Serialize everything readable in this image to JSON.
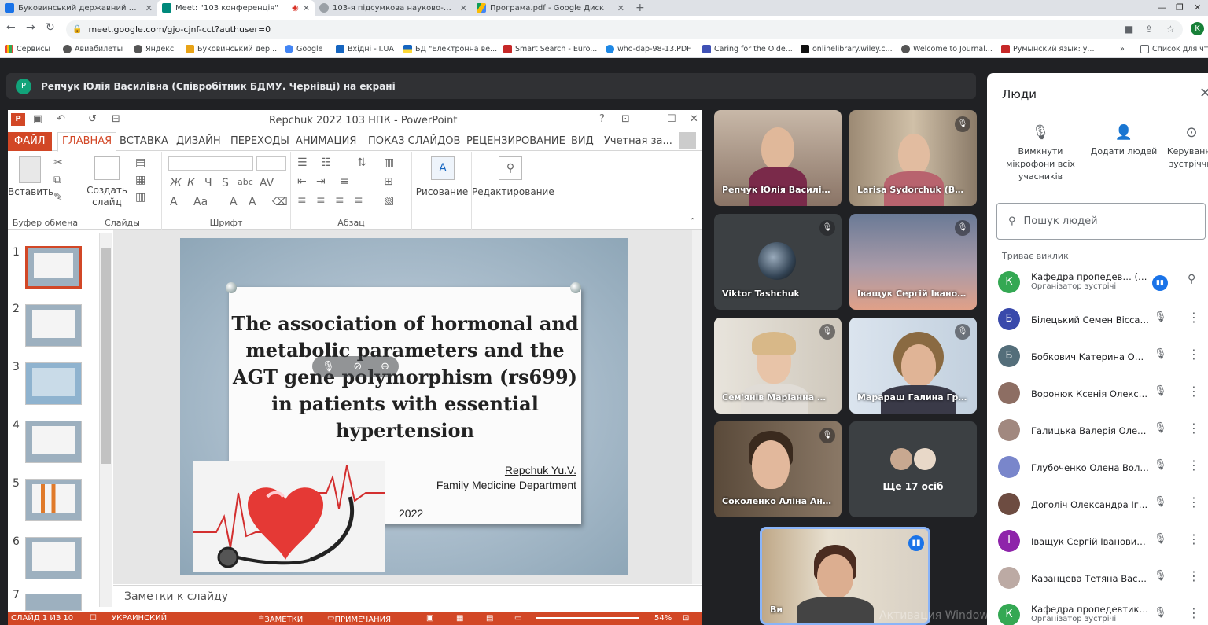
{
  "browser": {
    "tabs": [
      {
        "title": "Буковинський державний медичн…",
        "color": "#1a73e8"
      },
      {
        "title": "Meet: \"103 конференція\"",
        "color": "#00897b",
        "recording": true
      },
      {
        "title": "103-я підсумкова науково-прак…",
        "color": "#5f6368"
      },
      {
        "title": "Програма.pdf - Google Диск",
        "color": "#fbbc04"
      }
    ],
    "url": "meet.google.com/gjo-cjnf-cct?authuser=0",
    "profile_letter": "K",
    "bookmarks": [
      "Сервисы",
      "Авиабилеты",
      "Яндекс",
      "Буковинський дер...",
      "Google",
      "Вхідні - I.UA",
      "БД \"Електронна ве...",
      "Smart Search - Euro...",
      "who-dap-98-13.PDF",
      "Caring for the Olde...",
      "onlinelibrary.wiley.c...",
      "Welcome to Journal...",
      "Румынский язык: у...",
      "»",
      "Список для чт"
    ]
  },
  "meet": {
    "presenter_banner": "Репчук Юлія Василівна (Співробітник БДМУ. Чернівці) на екрані",
    "presenter_avatar": "Р",
    "tiles": [
      {
        "name": "Репчук Юлія Василівн…",
        "muted": false
      },
      {
        "name": "Larisa Sydorchuk (BS…",
        "muted": true
      },
      {
        "name": "Viktor Tashchuk",
        "muted": true
      },
      {
        "name": "Іващук Сергій Іванов…",
        "muted": true
      },
      {
        "name": "Сем'янів Маріанна М…",
        "muted": true
      },
      {
        "name": "Марараш Галина Григ…",
        "muted": true
      },
      {
        "name": "Соколенко Аліна Анд…",
        "muted": true
      },
      {
        "name": "Ще 17 осіб",
        "muted": false
      },
      {
        "name": "Ви",
        "muted": false
      }
    ],
    "watermark": "Активация Windows"
  },
  "powerpoint": {
    "window_title": "Repchuk 2022 103 НПК - PowerPoint",
    "menu": [
      "ФАЙЛ",
      "ГЛАВНАЯ",
      "ВСТАВКА",
      "ДИЗАЙН",
      "ПЕРЕХОДЫ",
      "АНИМАЦИЯ",
      "ПОКАЗ СЛАЙДОВ",
      "РЕЦЕНЗИРОВАНИЕ",
      "ВИД",
      "Учетная за..."
    ],
    "ribbon": {
      "paste": "Вставить",
      "new_slide": "Создать слайд",
      "draw": "Рисование",
      "edit": "Редактирование",
      "groups": [
        "Буфер обмена",
        "Слайды",
        "Шрифт",
        "Абзац"
      ]
    },
    "slide_numbers": [
      "1",
      "2",
      "3",
      "4",
      "5",
      "6",
      "7"
    ],
    "slide": {
      "title": "The association of hormonal and metabolic parameters and the AGT gene polymorphism (rs699) in patients with essential hypertension",
      "author": "Repchuk Yu.V.",
      "department": "Family Medicine Department",
      "year": "2022"
    },
    "notes_placeholder": "Заметки к слайду",
    "status": {
      "slide_of": "СЛАЙД 1 ИЗ 10",
      "language": "УКРАИНСКИЙ",
      "notes": "ЗАМЕТКИ",
      "comments": "ПРИМЕЧАНИЯ",
      "zoom": "54%"
    }
  },
  "people_panel": {
    "title": "Люди",
    "actions": [
      "Вимкнути мікрофони всіх учасників",
      "Додати людей",
      "Керування зустріччю"
    ],
    "search_placeholder": "Пошук людей",
    "section": "Триває виклик",
    "people": [
      {
        "name": "Кафедра пропедев… (Ви)",
        "sub": "Організатор зустрічі",
        "letter": "К",
        "color": "#34a853",
        "speaking": true
      },
      {
        "name": "Білецький Семен Віссарі…",
        "sub": "",
        "letter": "Б",
        "color": "#3949ab"
      },
      {
        "name": "Бобкович Катерина Оле…",
        "sub": "",
        "letter": "Б",
        "color": "#546e7a"
      },
      {
        "name": "Воронюк Ксенія Олекса…",
        "sub": "",
        "letter": "",
        "color": "#8d6e63"
      },
      {
        "name": "Галицька Валерія Олекс…",
        "sub": "",
        "letter": "",
        "color": "#a1887f"
      },
      {
        "name": "Глубоченко Олена Воло…",
        "sub": "",
        "letter": "",
        "color": "#7986cb"
      },
      {
        "name": "Доголіч Олександра Іго…",
        "sub": "",
        "letter": "",
        "color": "#6d4c41"
      },
      {
        "name": "Іващук Сергій Іванович (…",
        "sub": "",
        "letter": "І",
        "color": "#8e24aa"
      },
      {
        "name": "Казанцева Тетяна Василі…",
        "sub": "",
        "letter": "",
        "color": "#bcaaa4"
      },
      {
        "name": "Кафедра пропедевтики …",
        "sub": "Організатор зустрічі",
        "letter": "К",
        "color": "#34a853"
      }
    ]
  }
}
